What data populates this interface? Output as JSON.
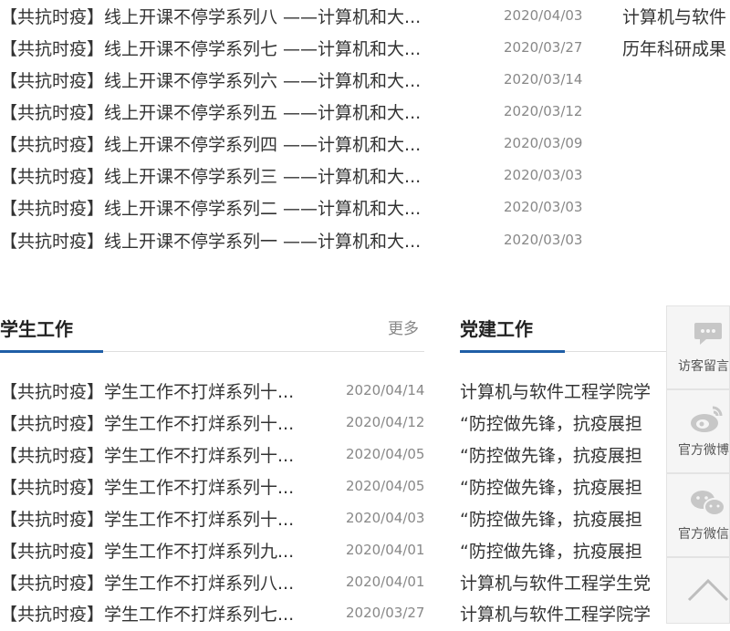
{
  "top_news": [
    {
      "title": "【共抗时疫】线上开课不停学系列八 ——计算机和大...",
      "date": "2020/04/03"
    },
    {
      "title": "【共抗时疫】线上开课不停学系列七 ——计算机和大...",
      "date": "2020/03/27"
    },
    {
      "title": "【共抗时疫】线上开课不停学系列六 ——计算机和大...",
      "date": "2020/03/14"
    },
    {
      "title": "【共抗时疫】线上开课不停学系列五 ——计算机和大...",
      "date": "2020/03/12"
    },
    {
      "title": "【共抗时疫】线上开课不停学系列四 ——计算机和大...",
      "date": "2020/03/09"
    },
    {
      "title": "【共抗时疫】线上开课不停学系列三 ——计算机和大...",
      "date": "2020/03/03"
    },
    {
      "title": "【共抗时疫】线上开课不停学系列二 ——计算机和大...",
      "date": "2020/03/03"
    },
    {
      "title": "【共抗时疫】线上开课不停学系列一 ——计算机和大...",
      "date": "2020/03/03"
    }
  ],
  "right_top": [
    "计算机与软件",
    "历年科研成果"
  ],
  "student_work": {
    "heading": "学生工作",
    "more": "更多",
    "items": [
      {
        "title": "【共抗时疫】学生工作不打烊系列十...",
        "date": "2020/04/14"
      },
      {
        "title": "【共抗时疫】学生工作不打烊系列十...",
        "date": "2020/04/12"
      },
      {
        "title": "【共抗时疫】学生工作不打烊系列十...",
        "date": "2020/04/05"
      },
      {
        "title": "【共抗时疫】学生工作不打烊系列十...",
        "date": "2020/04/05"
      },
      {
        "title": "【共抗时疫】学生工作不打烊系列十...",
        "date": "2020/04/03"
      },
      {
        "title": "【共抗时疫】学生工作不打烊系列九...",
        "date": "2020/04/01"
      },
      {
        "title": "【共抗时疫】学生工作不打烊系列八...",
        "date": "2020/04/01"
      },
      {
        "title": "【共抗时疫】学生工作不打烊系列七...",
        "date": "2020/03/27"
      }
    ]
  },
  "party_work": {
    "heading": "党建工作",
    "items": [
      "计算机与软件工程学院学",
      "“防控做先锋，抗疫展担",
      "“防控做先锋，抗疫展担",
      "“防控做先锋，抗疫展担",
      "“防控做先锋，抗疫展担",
      "“防控做先锋，抗疫展担",
      "计算机与软件工程学生党",
      "计算机与软件工程学院学"
    ]
  },
  "side_panel": {
    "visitor_label": "访客留言",
    "weibo_label": "官方微博",
    "wechat_label": "官方微信",
    "icons": [
      "chat-bubble-icon",
      "weibo-icon",
      "wechat-icon",
      "chevron-up-icon"
    ]
  },
  "colors": {
    "accent": "#1f5ea6",
    "date": "#888888",
    "text": "#333333"
  }
}
